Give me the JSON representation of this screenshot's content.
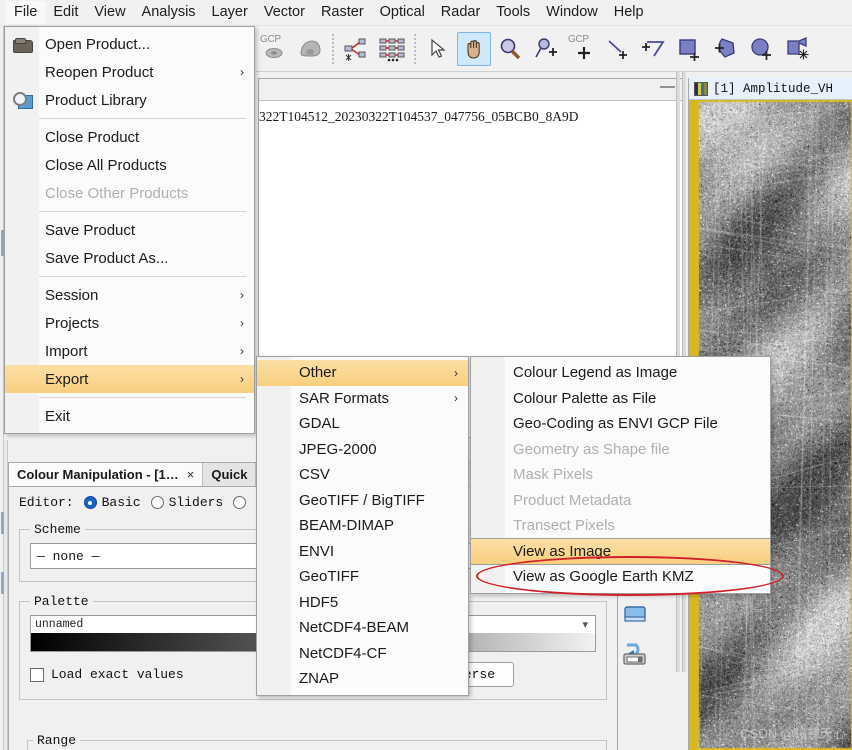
{
  "menubar": {
    "items": [
      {
        "label": "File",
        "active": true
      },
      {
        "label": "Edit",
        "active": false
      },
      {
        "label": "View",
        "active": false
      },
      {
        "label": "Analysis",
        "active": false
      },
      {
        "label": "Layer",
        "active": false
      },
      {
        "label": "Vector",
        "active": false
      },
      {
        "label": "Raster",
        "active": false
      },
      {
        "label": "Optical",
        "active": false
      },
      {
        "label": "Radar",
        "active": false
      },
      {
        "label": "Tools",
        "active": false
      },
      {
        "label": "Window",
        "active": false
      },
      {
        "label": "Help",
        "active": false
      }
    ]
  },
  "toolbar": {
    "buttons": [
      {
        "name": "gcp-manager-icon",
        "label": "GCP",
        "selected": false
      },
      {
        "name": "pin-manager-icon",
        "label": "",
        "selected": false
      },
      {
        "name": "sep-1",
        "label": "",
        "selected": false
      },
      {
        "name": "graph-builder-icon",
        "label": "",
        "selected": false
      },
      {
        "name": "batch-processing-icon",
        "label": "",
        "selected": false
      },
      {
        "name": "sep-2",
        "label": "",
        "selected": false
      },
      {
        "name": "selection-tool-icon",
        "label": "",
        "selected": false
      },
      {
        "name": "pan-tool-icon",
        "label": "",
        "selected": true
      },
      {
        "name": "zoom-tool-icon",
        "label": "",
        "selected": false
      },
      {
        "name": "pin-placing-tool-icon",
        "label": "",
        "selected": false
      },
      {
        "name": "gcp-placing-tool-icon",
        "label": "GCP",
        "selected": false
      },
      {
        "name": "line-drawing-tool-icon",
        "label": "",
        "selected": false
      },
      {
        "name": "polyline-drawing-tool-icon",
        "label": "",
        "selected": false
      },
      {
        "name": "rectangle-drawing-tool-icon",
        "label": "",
        "selected": false
      },
      {
        "name": "polygon-drawing-tool-icon",
        "label": "",
        "selected": false
      },
      {
        "name": "ellipse-drawing-tool-icon",
        "label": "",
        "selected": false
      },
      {
        "name": "magic-wand-tool-icon",
        "label": "",
        "selected": false
      }
    ]
  },
  "file_menu": {
    "items": [
      {
        "label": "Open Product...",
        "icon": "open-folder-icon",
        "arrow": false,
        "disabled": false,
        "highlight": false
      },
      {
        "label": "Reopen Product",
        "icon": "",
        "arrow": true,
        "disabled": false,
        "highlight": false
      },
      {
        "label": "Product Library",
        "icon": "product-library-icon",
        "arrow": false,
        "disabled": false,
        "highlight": false
      },
      {
        "separator": true
      },
      {
        "label": "Close Product",
        "icon": "",
        "arrow": false,
        "disabled": false,
        "highlight": false
      },
      {
        "label": "Close All Products",
        "icon": "",
        "arrow": false,
        "disabled": false,
        "highlight": false
      },
      {
        "label": "Close Other Products",
        "icon": "",
        "arrow": false,
        "disabled": true,
        "highlight": false
      },
      {
        "separator": true
      },
      {
        "label": "Save Product",
        "icon": "",
        "arrow": false,
        "disabled": false,
        "highlight": false
      },
      {
        "label": "Save Product As...",
        "icon": "",
        "arrow": false,
        "disabled": false,
        "highlight": false
      },
      {
        "separator": true
      },
      {
        "label": "Session",
        "icon": "",
        "arrow": true,
        "disabled": false,
        "highlight": false
      },
      {
        "label": "Projects",
        "icon": "",
        "arrow": true,
        "disabled": false,
        "highlight": false
      },
      {
        "label": "Import",
        "icon": "",
        "arrow": true,
        "disabled": false,
        "highlight": false
      },
      {
        "label": "Export",
        "icon": "",
        "arrow": true,
        "disabled": false,
        "highlight": true
      },
      {
        "separator": true
      },
      {
        "label": "Exit",
        "icon": "",
        "arrow": false,
        "disabled": false,
        "highlight": false
      }
    ]
  },
  "export_menu": {
    "items": [
      {
        "label": "Other",
        "arrow": true,
        "disabled": false,
        "highlight": true
      },
      {
        "label": "SAR Formats",
        "arrow": true,
        "disabled": false,
        "highlight": false
      },
      {
        "label": "GDAL",
        "arrow": false,
        "disabled": false,
        "highlight": false
      },
      {
        "label": "JPEG-2000",
        "arrow": false,
        "disabled": false,
        "highlight": false
      },
      {
        "label": "CSV",
        "arrow": false,
        "disabled": false,
        "highlight": false
      },
      {
        "label": "GeoTIFF / BigTIFF",
        "arrow": false,
        "disabled": false,
        "highlight": false
      },
      {
        "label": "BEAM-DIMAP",
        "arrow": false,
        "disabled": false,
        "highlight": false
      },
      {
        "label": "ENVI",
        "arrow": false,
        "disabled": false,
        "highlight": false
      },
      {
        "label": "GeoTIFF",
        "arrow": false,
        "disabled": false,
        "highlight": false
      },
      {
        "label": "HDF5",
        "arrow": false,
        "disabled": false,
        "highlight": false
      },
      {
        "label": "NetCDF4-BEAM",
        "arrow": false,
        "disabled": false,
        "highlight": false
      },
      {
        "label": "NetCDF4-CF",
        "arrow": false,
        "disabled": false,
        "highlight": false
      },
      {
        "label": "ZNAP",
        "arrow": false,
        "disabled": false,
        "highlight": false
      }
    ]
  },
  "other_menu": {
    "items": [
      {
        "label": "Colour Legend as Image",
        "disabled": false,
        "highlight": false
      },
      {
        "label": "Colour Palette as File",
        "disabled": false,
        "highlight": false
      },
      {
        "label": "Geo-Coding as ENVI GCP File",
        "disabled": false,
        "highlight": false
      },
      {
        "label": "Geometry as Shape file",
        "disabled": true,
        "highlight": false
      },
      {
        "label": "Mask Pixels",
        "disabled": true,
        "highlight": false
      },
      {
        "label": "Product Metadata",
        "disabled": true,
        "highlight": false
      },
      {
        "label": "Transect Pixels",
        "disabled": true,
        "highlight": false
      },
      {
        "label": "View as Image",
        "disabled": false,
        "highlight": true
      },
      {
        "label": "View as Google Earth KMZ",
        "disabled": false,
        "highlight": false
      }
    ]
  },
  "document_window": {
    "product_path": "322T104512_20230322T104537_047756_05BCB0_8A9D",
    "minimize_label": "—"
  },
  "image_view": {
    "tab_label": "[1] Amplitude_VH",
    "watermark": "CSDN @铭裸天心"
  },
  "colour_manipulation": {
    "tab_title": "Colour Manipulation - [1…",
    "tab_close": "×",
    "second_tab_title": "Quick",
    "editor_label": "Editor:",
    "editor_options": [
      {
        "label": "Basic",
        "selected": true
      },
      {
        "label": "Sliders",
        "selected": false
      },
      {
        "label": "",
        "selected": false
      }
    ],
    "scheme_legend": "Scheme",
    "scheme_value": "— none —",
    "palette_legend": "Palette",
    "palette_name": "unnamed",
    "load_exact_values_label": "Load exact values",
    "load_exact_values_checked": false,
    "reverse_button": "Reverse",
    "range_legend": "Range",
    "export_colour_palette_icon": "export-palette-icon"
  },
  "colors": {
    "menu_highlight_top": "#fcdfa5",
    "menu_highlight_bottom": "#f9cf7f",
    "annotation_red": "#cf1f28",
    "toolbar_selected_bg": "#cfe8fb",
    "tool_purple": "#7b7fc4",
    "panel_bg": "#f0f0f0",
    "radio_accent": "#1565c0",
    "image_border_yellow": "#d8b820"
  }
}
